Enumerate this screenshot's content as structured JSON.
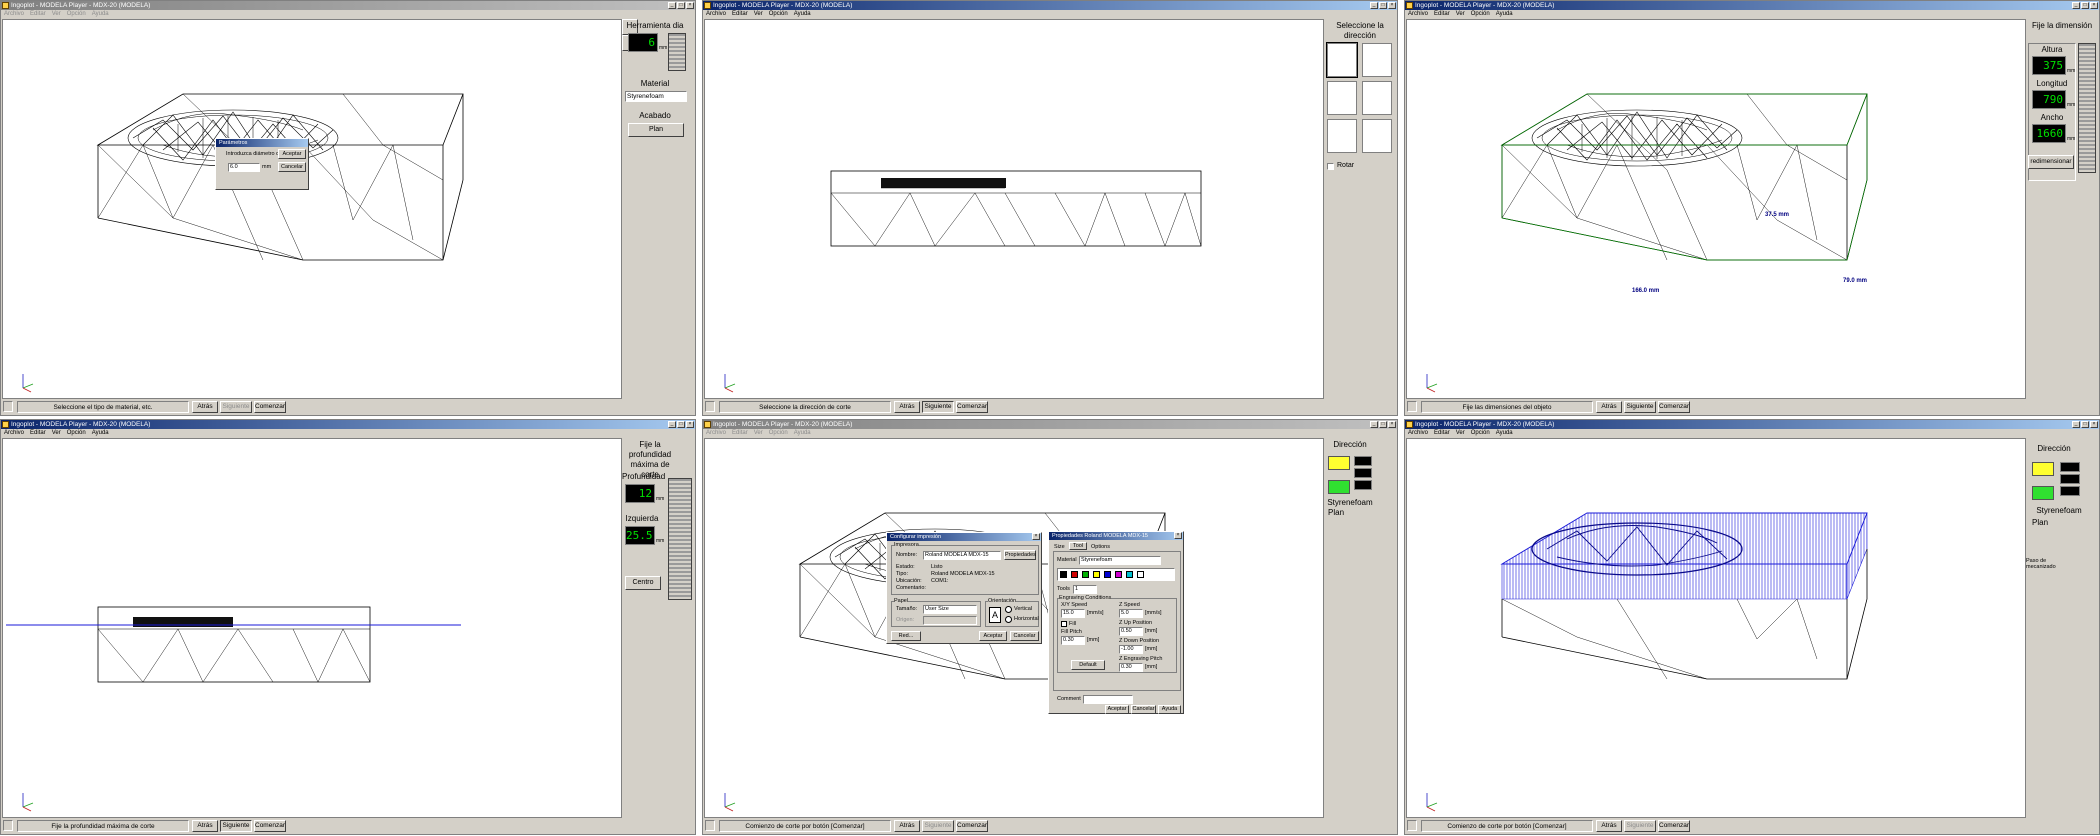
{
  "menu": [
    "Archivo",
    "Editar",
    "Ver",
    "Opción",
    "Ayuda"
  ],
  "icons": {
    "app": "app-icon",
    "minimize": "minimize-icon",
    "maximize": "maximize-icon",
    "close": "close-icon",
    "status": "head-icon",
    "rotate": "rotate-icon",
    "axes": "axis-gizmo-icon"
  },
  "colors": {
    "titlebar_active": "#0a246a",
    "lcd_text": "#00e000",
    "toolpath_blue": "#1a1ad8",
    "cube_yellow": "#ffff30",
    "cube_green": "#30e030",
    "dimension_text": "#000080",
    "bound_green": "#008000"
  },
  "windows": [
    {
      "id": "w1",
      "title": "Ingoplot - MODELA Player - MDX-20 (MODELA)",
      "status": "Seleccione el tipo de material, etc.",
      "buttons": [
        "Atrás",
        "Siguiente",
        "Comenzar"
      ],
      "panel": {
        "header": "Herramienta dia",
        "tool_value": "6",
        "tool_unit": "mm",
        "material_label": "Material",
        "material_value": "Styrenefoam",
        "acabado_label": "Acabado",
        "plan_button": "Plan"
      },
      "dialog": {
        "title": "Parámetros",
        "prompt": "Introduzca diámetro de",
        "value": "6.0",
        "unit": "mm",
        "ok": "Aceptar",
        "cancel": "Cancelar"
      }
    },
    {
      "id": "w2",
      "title": "Ingoplot - MODELA Player - MDX-20 (MODELA)",
      "status": "Seleccione la dirección de corte",
      "buttons": [
        "Atrás",
        "Siguiente",
        "Comenzar"
      ],
      "panel": {
        "header": "Seleccione la dirección",
        "rotate_label": "Rotar"
      }
    },
    {
      "id": "w3",
      "title": "Ingoplot - MODELA Player - MDX-20 (MODELA)",
      "status": "Fije las dimensiones del objeto",
      "buttons": [
        "Atrás",
        "Siguiente",
        "Comenzar"
      ],
      "panel": {
        "header": "Fije la dimensión",
        "altura_label": "Altura",
        "altura_value": "375",
        "longitud_label": "Longitud",
        "longitud_value": "790",
        "ancho_label": "Ancho",
        "ancho_value": "1660",
        "unit": "mm",
        "redim_button": "redimensionar"
      },
      "dims": {
        "height": "37.5 mm",
        "width": "166.0 mm",
        "depth": "79.0 mm"
      }
    },
    {
      "id": "w4",
      "title": "Ingoplot - MODELA Player - MDX-20 (MODELA)",
      "status": "Fije la profundidad máxima de corte",
      "buttons": [
        "Atrás",
        "Siguiente",
        "Comenzar"
      ],
      "panel": {
        "header": "Fije la profundidad máxima de corte",
        "prof_label": "Profundidad",
        "prof_value": "12",
        "izq_label": "Izquierda",
        "izq_value": "25.5",
        "unit": "mm",
        "centro_button": "Centro"
      }
    },
    {
      "id": "w5",
      "title": "Ingoplot - MODELA Player - MDX-20 (MODELA)",
      "status": "Comienzo de corte por botón [Comenzar]",
      "buttons": [
        "Atrás",
        "Siguiente",
        "Comenzar"
      ],
      "panel": {
        "header": "Dirección",
        "plan_label": "Plan",
        "material_label": "Styrenefoam"
      },
      "print_dialog": {
        "title": "Configurar impresión",
        "impresora": "Impresora",
        "nombre_label": "Nombre:",
        "nombre_value": "Roland MODELA MDX-15",
        "propiedades": "Propiedades",
        "estado_label": "Estado:",
        "estado_value": "Listo",
        "tipo_label": "Tipo:",
        "tipo_value": "Roland MODELA MDX-15",
        "ubicacion_label": "Ubicación:",
        "ubicacion_value": "COM1:",
        "comentario_label": "Comentario:",
        "papel": "Papel",
        "tamano_label": "Tamaño:",
        "tamano_value": "User Size",
        "origen_label": "Origen:",
        "orientacion": "Orientación",
        "vertical": "Vertical",
        "horizontal": "Horizontal",
        "red": "Red...",
        "aceptar": "Aceptar",
        "cancelar": "Cancelar"
      },
      "props_dialog": {
        "title": "Propiedades Roland MODELA MDX-15",
        "tabs": [
          "Size",
          "Tool",
          "Options"
        ],
        "material_label": "Material",
        "material_value": "Styrenefoam",
        "tools_label": "Tools",
        "tools_value": "1",
        "cond_label": "Engraving Conditions",
        "xy_label": "X/Y Speed",
        "xy_value": "15.0",
        "xy_unit": "[mm/s]",
        "z_label": "Z Speed",
        "z_value": "5.0",
        "z_unit": "[mm/s]",
        "up_label": "Z Up Position",
        "up_value": "0.50",
        "mm": "[mm]",
        "fill_label": "Fill",
        "fillpitch_label": "Fill Pitch",
        "fillpitch_value": "0.30",
        "down_label": "Z Down Position",
        "down_value": "-1.00",
        "pitch_label": "Z Engraving Pitch",
        "pitch_value": "0.30",
        "default": "Default",
        "comment_label": "Comment",
        "aceptar": "Aceptar",
        "cancelar": "Cancelar",
        "ayuda": "Ayuda"
      }
    },
    {
      "id": "w6",
      "title": "Ingoplot - MODELA Player - MDX-20 (MODELA)",
      "status": "Comienzo de corte por botón [Comenzar]",
      "buttons": [
        "Atrás",
        "Siguiente",
        "Comenzar"
      ],
      "panel": {
        "header": "Dirección",
        "material_label": "Styrenefoam",
        "plan_label": "Plan",
        "paso_label": "Paso de mecanizado"
      }
    }
  ]
}
